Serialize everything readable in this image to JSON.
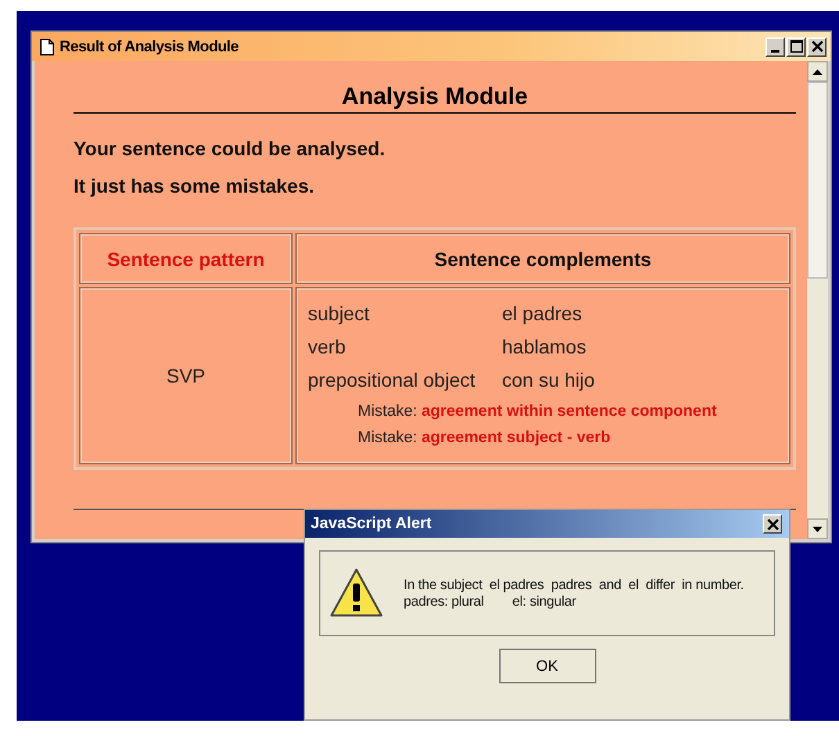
{
  "window": {
    "title": "Result of Analysis Module"
  },
  "heading": "Analysis Module",
  "messages": [
    "Your sentence could be analysed.",
    "It just has some mistakes."
  ],
  "table": {
    "columns": [
      "Sentence pattern",
      "Sentence complements"
    ],
    "pattern": "SVP",
    "complements": [
      {
        "role": "subject",
        "phrase": "el padres"
      },
      {
        "role": "verb",
        "phrase": "hablamos"
      },
      {
        "role": "prepositional object",
        "phrase": "con su hijo"
      }
    ],
    "mistakes": [
      {
        "label": "Mistake:",
        "text": "agreement within sentence component"
      },
      {
        "label": "Mistake:",
        "text": "agreement subject - verb"
      }
    ]
  },
  "alert": {
    "title": "JavaScript Alert",
    "lines": [
      "In the subject  el padres  padres  and  el  differ  in number.",
      "padres: plural        el: singular"
    ],
    "button": "OK"
  }
}
